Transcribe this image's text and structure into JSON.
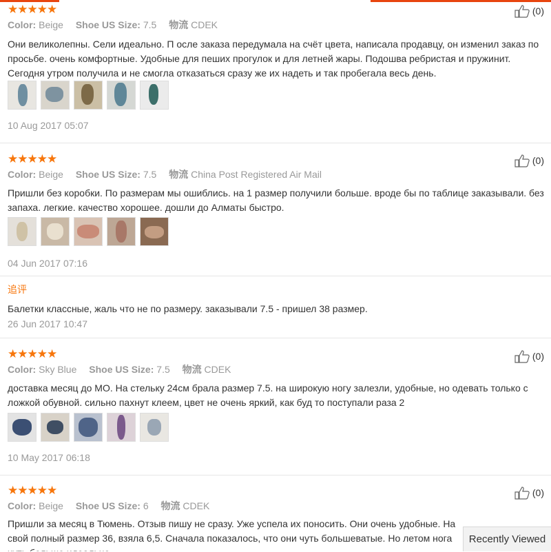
{
  "reviews": [
    {
      "stars": "★★★★★",
      "color_label": "Color:",
      "color_value": "Beige",
      "size_label": "Shoe US Size:",
      "size_value": "7.5",
      "logistics_label": "物流",
      "logistics_value": "CDEK",
      "likes": "(0)",
      "text": "Они великолепны. Сели идеально. П осле заказа передумала на счёт цвета, написала продавцу, он изменил заказ по просьбе. очень комфортные. Удобные для пеших прогулок и для летней жары. Подошва ребристая и пружинит. Сегодня утром получила и не смогла отказаться сразу же их надеть и так пробегала весь день.",
      "date": "10 Aug 2017 05:07"
    },
    {
      "stars": "★★★★★",
      "color_label": "Color:",
      "color_value": "Beige",
      "size_label": "Shoe US Size:",
      "size_value": "7.5",
      "logistics_label": "物流",
      "logistics_value": "China Post Registered Air Mail",
      "likes": "(0)",
      "text": "Пришли без коробки. По размерам мы ошиблись. на 1 размер получили больше. вроде бы по таблице заказывали. без запаха. легкие. качество хорошее. дошли до Алматы быстро.",
      "date": "04 Jun 2017 07:16",
      "addon_title": "追评",
      "addon_text": "Балетки классные, жаль что не по размеру. заказывали 7.5 - пришел 38 размер.",
      "addon_date": "26 Jun 2017 10:47"
    },
    {
      "stars": "★★★★★",
      "color_label": "Color:",
      "color_value": "Sky Blue",
      "size_label": "Shoe US Size:",
      "size_value": "7.5",
      "logistics_label": "物流",
      "logistics_value": "CDEK",
      "likes": "(0)",
      "text": "доставка месяц до МО. На стельку 24см брала размер 7.5. на широкую ногу залезли, удобные, но одевать только с ложкой обувной. сильно пахнут клеем, цвет не очень яркий, как буд то поступали раза 2",
      "date": "10 May 2017 06:18"
    },
    {
      "stars": "★★★★★",
      "color_label": "Color:",
      "color_value": "Beige",
      "size_label": "Shoe US Size:",
      "size_value": "6",
      "logistics_label": "物流",
      "logistics_value": "CDEK",
      "likes": "(0)",
      "text": "Пришли за месяц в Тюмень. Отзыв пишу не сразу. Уже успела их поносить. Они очень удобные. На свой полный размер 36, взяла 6,5. Сначала показалось, что они чуть большеватые. Но летом нога чуть больше идеально."
    }
  ],
  "recently_viewed": "Recently Viewed",
  "colors": {
    "accent": "#f7760c",
    "topbar": "#e8450f"
  }
}
